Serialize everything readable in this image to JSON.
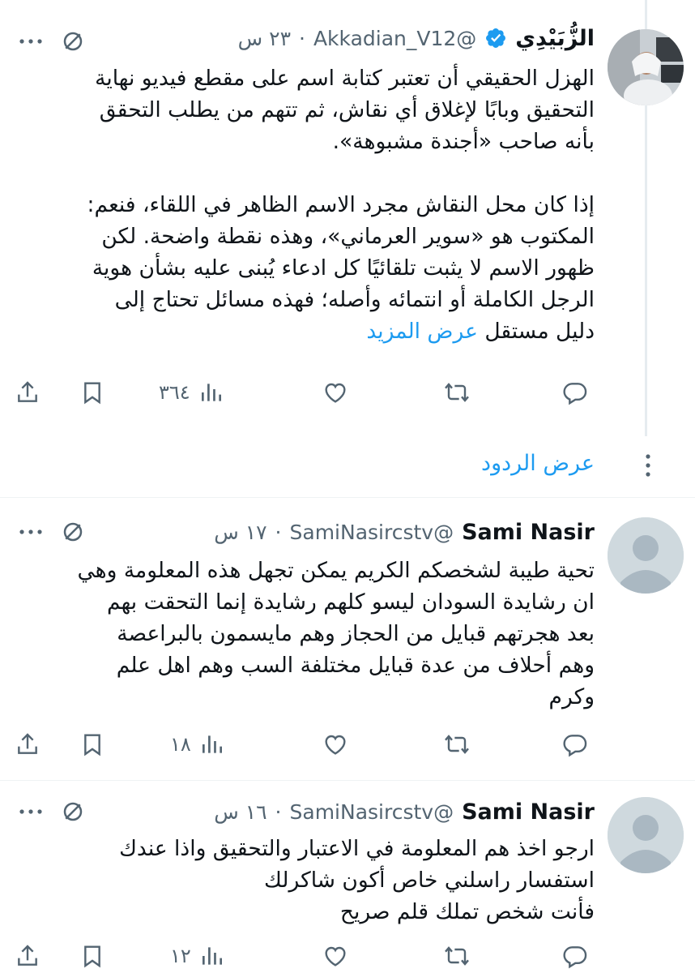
{
  "posts": [
    {
      "name": "الزُّبَيْدِي",
      "verified": true,
      "handle": "@Akkadian_V12",
      "time": "٢٣ س",
      "text": "الهزل الحقيقي أن تعتبر كتابة اسم على مقطع فيديو نهاية التحقيق وبابًا لإغلاق أي نقاش، ثم تتهم من يطلب التحقق بأنه صاحب «أجندة مشبوهة».\n\nإذا كان محل النقاش مجرد الاسم الظاهر في اللقاء، فنعم: المكتوب هو «سوير العرماني»، وهذه نقطة واضحة. لكن ظهور الاسم لا يثبت تلقائيًا كل ادعاء يُبنى عليه بشأن هوية الرجل الكاملة أو انتمائه وأصله؛ فهذه مسائل تحتاج إلى دليل مستقل ",
      "show_more": "عرض المزيد",
      "views": "٣٦٤"
    },
    {
      "name": "Sami Nasir",
      "verified": false,
      "handle": "@SamiNasircstv",
      "time": "١٧ س",
      "text": "تحية طيبة لشخصكم الكريم يمكن تجهل هذه المعلومة وهي ان رشايدة السودان  ليسو كلهم  رشايدة إنما التحقت بهم بعد هجرتهم قبايل  من الحجاز  وهم مايسمون بالبراعصة وهم أحلاف من عدة قبايل   مختلفة السب  وهم اهل علم وكرم",
      "views": "١٨"
    },
    {
      "name": "Sami Nasir",
      "verified": false,
      "handle": "@SamiNasircstv",
      "time": "١٦ س",
      "text": "ارجو اخذ هم المعلومة في  الاعتبار  والتحقيق واذا عندك استفسار راسلني خاص أكون شاكرلك\nفأنت شخص تملك قلم صريح",
      "views": "١٢"
    }
  ],
  "show_replies": "عرض الردود",
  "colors": {
    "accent": "#1d9bf0",
    "secondary": "#536471",
    "divider": "#eff3f4"
  },
  "icons": [
    "reply-icon",
    "repost-icon",
    "like-icon",
    "views-icon",
    "bookmark-icon",
    "share-icon",
    "grok-icon",
    "more-icon",
    "verified-badge-icon"
  ]
}
